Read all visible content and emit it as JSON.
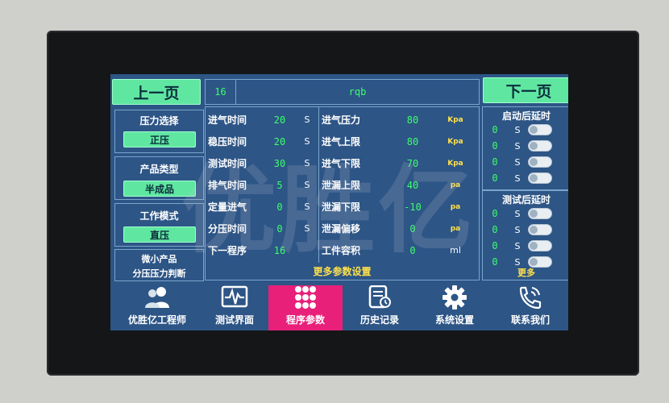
{
  "watermark": "优胜亿",
  "nav_top": {
    "prev_page": "上一页",
    "next_page": "下一页"
  },
  "header": {
    "program_no": "16",
    "program_name": "rqb"
  },
  "left_panel": {
    "pressure_select": {
      "title": "压力选择",
      "value": "正压"
    },
    "product_type": {
      "title": "产品类型",
      "value": "半成品"
    },
    "work_mode": {
      "title": "工作模式",
      "value": "直压"
    },
    "small_product": {
      "line1": "微小产品",
      "line2": "分压压力判断"
    }
  },
  "params_left": [
    {
      "label": "进气时间",
      "value": "20",
      "unit": "S"
    },
    {
      "label": "稳压时间",
      "value": "20",
      "unit": "S"
    },
    {
      "label": "测试时间",
      "value": "30",
      "unit": "S"
    },
    {
      "label": "排气时间",
      "value": "5",
      "unit": "S"
    },
    {
      "label": "定量进气",
      "value": "0",
      "unit": "S"
    },
    {
      "label": "分压时间",
      "value": "0",
      "unit": "S"
    },
    {
      "label": "下一程序",
      "value": "16",
      "unit": ""
    }
  ],
  "params_right": [
    {
      "label": "进气压力",
      "value": "80",
      "unit": "Kpa"
    },
    {
      "label": "进气上限",
      "value": "80",
      "unit": "Kpa"
    },
    {
      "label": "进气下限",
      "value": "70",
      "unit": "Kpa"
    },
    {
      "label": "泄漏上限",
      "value": "40",
      "unit": "pa"
    },
    {
      "label": "泄漏下限",
      "value": "-10",
      "unit": "pa"
    },
    {
      "label": "泄漏偏移",
      "value": "0",
      "unit": "pa"
    },
    {
      "label": "工件容积",
      "value": "0",
      "unit": "ml"
    }
  ],
  "more_params": "更多参数设置",
  "delay_after_start": {
    "title": "启动后延时",
    "rows": [
      {
        "value": "0",
        "unit": "S",
        "on": false
      },
      {
        "value": "0",
        "unit": "S",
        "on": false
      },
      {
        "value": "0",
        "unit": "S",
        "on": false
      },
      {
        "value": "0",
        "unit": "S",
        "on": false
      }
    ]
  },
  "delay_after_test": {
    "title": "测试后延时",
    "rows": [
      {
        "value": "0",
        "unit": "S",
        "on": false
      },
      {
        "value": "0",
        "unit": "S",
        "on": false
      },
      {
        "value": "0",
        "unit": "S",
        "on": false
      },
      {
        "value": "0",
        "unit": "S",
        "on": false
      }
    ]
  },
  "more": "更多",
  "bottom_nav": [
    {
      "label": "优胜亿工程师",
      "icon": "users-icon",
      "active": false
    },
    {
      "label": "测试界面",
      "icon": "waveform-icon",
      "active": false
    },
    {
      "label": "程序参数",
      "icon": "grid-dots-icon",
      "active": true
    },
    {
      "label": "历史记录",
      "icon": "history-icon",
      "active": false
    },
    {
      "label": "系统设置",
      "icon": "gear-icon",
      "active": false
    },
    {
      "label": "联系我们",
      "icon": "phone-icon",
      "active": false
    }
  ],
  "colors": {
    "screen_bg": "#2d5586",
    "button_green": "#5fe7a1",
    "value_green": "#3cff6a",
    "unit_yellow": "#ffe14a",
    "active_tab": "#e8207a"
  }
}
